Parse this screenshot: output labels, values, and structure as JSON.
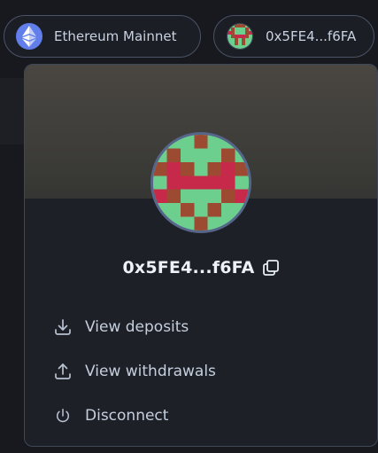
{
  "header": {
    "network_label": "Ethereum Mainnet",
    "account_label": "0x5FE4...f6FA"
  },
  "panel": {
    "address": "0x5FE4...f6FA",
    "menu": [
      {
        "label": "View deposits",
        "icon": "download-icon"
      },
      {
        "label": "View withdrawals",
        "icon": "upload-icon"
      },
      {
        "label": "Disconnect",
        "icon": "power-icon"
      }
    ]
  },
  "colors": {
    "background": "#17191e",
    "panel": "#1d2027",
    "ethereum": "#627eea",
    "avatar_green": "#6ccf8d",
    "avatar_brown": "#9c4a32",
    "avatar_red": "#c7294a"
  }
}
